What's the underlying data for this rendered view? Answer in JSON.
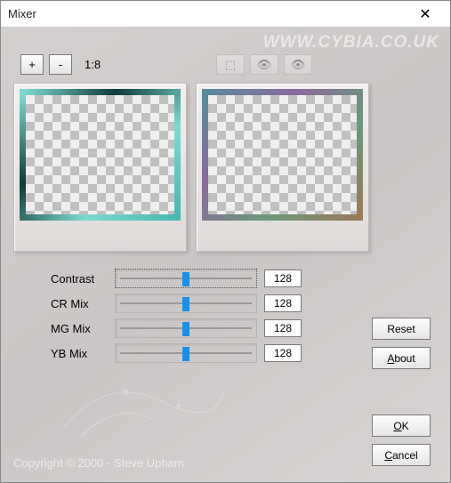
{
  "window": {
    "title": "Mixer"
  },
  "watermark": "WWW.CYBIA.CO.UK",
  "zoom": {
    "plus": "+",
    "minus": "-",
    "ratio": "1:8"
  },
  "sliders": [
    {
      "label": "Contrast",
      "value": "128",
      "focused": true
    },
    {
      "label": "CR Mix",
      "value": "128",
      "focused": false
    },
    {
      "label": "MG Mix",
      "value": "128",
      "focused": false
    },
    {
      "label": "YB Mix",
      "value": "128",
      "focused": false
    }
  ],
  "buttons": {
    "reset": "Reset",
    "about": "About",
    "ok": "OK",
    "cancel": "Cancel"
  },
  "copyright": "Copyright © 2000 - Steve Upham"
}
